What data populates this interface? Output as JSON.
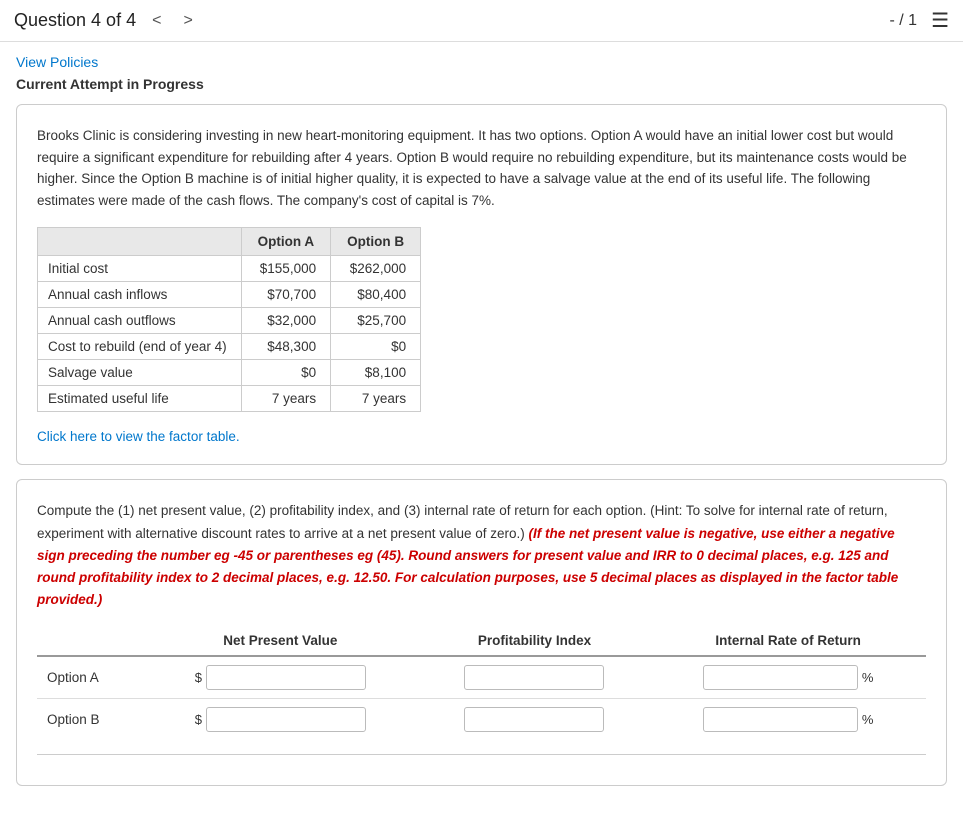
{
  "header": {
    "question_label": "Question 4 of 4",
    "nav_prev": "<",
    "nav_next": ">",
    "score": "- / 1",
    "menu_icon": "☰"
  },
  "subheader": {
    "view_policies": "View Policies",
    "attempt_label": "Current Attempt in Progress"
  },
  "info_card": {
    "paragraph": "Brooks Clinic is considering investing in new heart-monitoring equipment. It has two options. Option A would have an initial lower cost but would require a significant expenditure for rebuilding after 4 years. Option B would require no rebuilding expenditure, but its maintenance costs would be higher. Since the Option B machine is of initial higher quality, it is expected to have a salvage value at the end of its useful life. The following estimates were made of the cash flows. The company's cost of capital is 7%.",
    "table": {
      "headers": [
        "",
        "Option A",
        "Option B"
      ],
      "rows": [
        [
          "Initial cost",
          "$155,000",
          "$262,000"
        ],
        [
          "Annual cash inflows",
          "$70,700",
          "$80,400"
        ],
        [
          "Annual cash outflows",
          "$32,000",
          "$25,700"
        ],
        [
          "Cost to rebuild (end of year 4)",
          "$48,300",
          "$0"
        ],
        [
          "Salvage value",
          "$0",
          "$8,100"
        ],
        [
          "Estimated useful life",
          "7 years",
          "7 years"
        ]
      ]
    },
    "factor_link": "Click here to view the factor table."
  },
  "compute_card": {
    "intro_text": "Compute the (1) net present value, (2) profitability index, and (3) internal rate of return for each option. (Hint: To solve for internal rate of return, experiment with alternative discount rates to arrive at a net present value of zero.)",
    "red_text": "(If the net present value is negative, use either a negative sign preceding the number eg -45 or parentheses eg (45). Round answers for present value and IRR to 0 decimal places, e.g. 125 and round profitability index to 2 decimal places, e.g. 12.50. For calculation purposes, use 5 decimal places as displayed in the factor table provided.)",
    "answer_table": {
      "headers": [
        "",
        "Net Present Value",
        "Profitability Index",
        "Internal Rate of Return"
      ],
      "rows": [
        {
          "label": "Option A",
          "npv_prefix": "$",
          "npv_value": "",
          "pi_value": "",
          "irr_value": "",
          "irr_suffix": "%"
        },
        {
          "label": "Option B",
          "npv_prefix": "$",
          "npv_value": "",
          "pi_value": "",
          "irr_value": "",
          "irr_suffix": "%"
        }
      ]
    }
  }
}
